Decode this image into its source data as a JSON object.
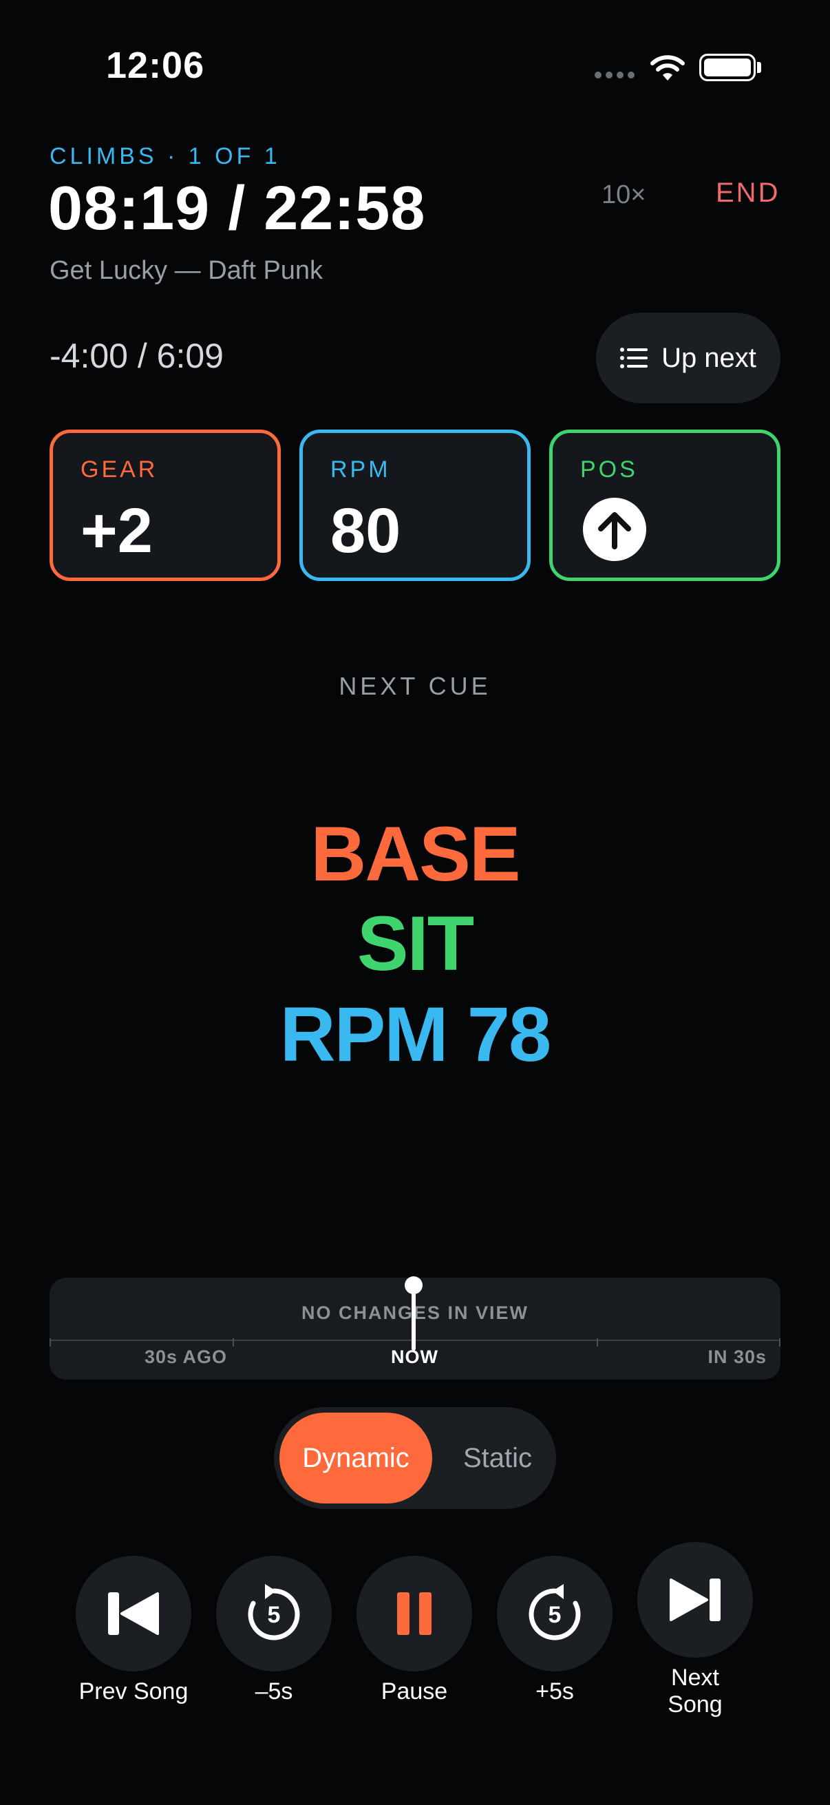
{
  "status_bar": {
    "time": "12:06"
  },
  "header": {
    "section": "CLIMBS · 1 OF 1",
    "elapsed": "08:19 / 22:58",
    "song": "Get Lucky — Daft Punk",
    "speed": "10×",
    "end_label": "END",
    "song_time": "-4:00 / 6:09",
    "up_next_label": "Up next"
  },
  "metrics": {
    "gear": {
      "label": "GEAR",
      "value": "+2",
      "color": "#ff6a3d"
    },
    "rpm": {
      "label": "RPM",
      "value": "80",
      "color": "#39b9f0"
    },
    "pos": {
      "label": "POS",
      "icon": "arrow-up-icon",
      "color": "#3fd46e"
    }
  },
  "next_cue": {
    "label": "NEXT CUE",
    "lines": [
      {
        "text": "BASE",
        "color": "#ff6a3d"
      },
      {
        "text": "SIT",
        "color": "#3fd46e"
      },
      {
        "text": "RPM 78",
        "color": "#39b9f0"
      }
    ]
  },
  "timeline": {
    "message": "NO CHANGES IN VIEW",
    "past_label": "30s AGO",
    "now_label": "NOW",
    "future_label": "IN 30s"
  },
  "mode": {
    "active": "Dynamic",
    "inactive": "Static"
  },
  "controls": {
    "prev_song": "Prev Song",
    "back5": "–5s",
    "back5_icon_number": "5",
    "pause": "Pause",
    "fwd5": "+5s",
    "fwd5_icon_number": "5",
    "next_song_line1": "Next",
    "next_song_line2": "Song"
  },
  "colors": {
    "accent": "#ff6a3d",
    "background": "#050607",
    "end": "#f2686c"
  }
}
